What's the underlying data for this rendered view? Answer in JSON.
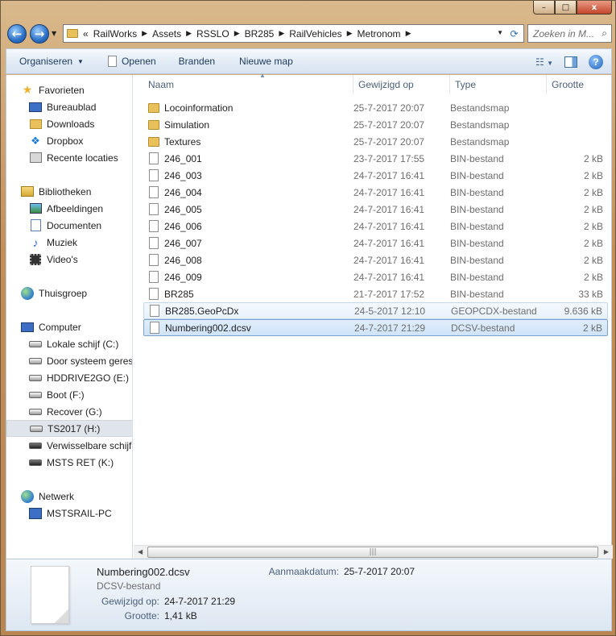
{
  "window": {
    "min_glyph": "–",
    "max_glyph": "□",
    "close_glyph": "x"
  },
  "address": {
    "overflow": "«",
    "crumbs": [
      "RailWorks",
      "Assets",
      "RSSLO",
      "BR285",
      "RailVehicles",
      "Metronom"
    ],
    "search_placeholder": "Zoeken in M..."
  },
  "toolbar": {
    "organize": "Organiseren",
    "open": "Openen",
    "burn": "Branden",
    "new_folder": "Nieuwe map"
  },
  "nav": {
    "favorites": "Favorieten",
    "desktop": "Bureaublad",
    "downloads": "Downloads",
    "dropbox": "Dropbox",
    "recent": "Recente locaties",
    "libraries": "Bibliotheken",
    "pictures": "Afbeeldingen",
    "documents": "Documenten",
    "music": "Muziek",
    "videos": "Video's",
    "homegroup": "Thuisgroep",
    "computer": "Computer",
    "drive_c": "Lokale schijf (C:)",
    "drive_reserved": "Door systeem gereserveerd",
    "drive_e": "HDDRIVE2GO (E:)",
    "drive_f": "Boot (F:)",
    "drive_g": "Recover (G:)",
    "drive_h": "TS2017 (H:)",
    "removable": "Verwisselbare schijf",
    "drive_k": "MSTS RET (K:)",
    "network": "Netwerk",
    "pc": "MSTSRAIL-PC"
  },
  "columns": {
    "name": "Naam",
    "modified": "Gewijzigd op",
    "type": "Type",
    "size": "Grootte"
  },
  "files": [
    {
      "name": "Locoinformation",
      "modified": "25-7-2017 20:07",
      "type": "Bestandsmap",
      "size": "",
      "icon": "folder"
    },
    {
      "name": "Simulation",
      "modified": "25-7-2017 20:07",
      "type": "Bestandsmap",
      "size": "",
      "icon": "folder"
    },
    {
      "name": "Textures",
      "modified": "25-7-2017 20:07",
      "type": "Bestandsmap",
      "size": "",
      "icon": "folder"
    },
    {
      "name": "246_001",
      "modified": "23-7-2017 17:55",
      "type": "BIN-bestand",
      "size": "2 kB",
      "icon": "file"
    },
    {
      "name": "246_003",
      "modified": "24-7-2017 16:41",
      "type": "BIN-bestand",
      "size": "2 kB",
      "icon": "file"
    },
    {
      "name": "246_004",
      "modified": "24-7-2017 16:41",
      "type": "BIN-bestand",
      "size": "2 kB",
      "icon": "file"
    },
    {
      "name": "246_005",
      "modified": "24-7-2017 16:41",
      "type": "BIN-bestand",
      "size": "2 kB",
      "icon": "file"
    },
    {
      "name": "246_006",
      "modified": "24-7-2017 16:41",
      "type": "BIN-bestand",
      "size": "2 kB",
      "icon": "file"
    },
    {
      "name": "246_007",
      "modified": "24-7-2017 16:41",
      "type": "BIN-bestand",
      "size": "2 kB",
      "icon": "file"
    },
    {
      "name": "246_008",
      "modified": "24-7-2017 16:41",
      "type": "BIN-bestand",
      "size": "2 kB",
      "icon": "file"
    },
    {
      "name": "246_009",
      "modified": "24-7-2017 16:41",
      "type": "BIN-bestand",
      "size": "2 kB",
      "icon": "file"
    },
    {
      "name": "BR285",
      "modified": "21-7-2017 17:52",
      "type": "BIN-bestand",
      "size": "33 kB",
      "icon": "file"
    },
    {
      "name": "BR285.GeoPcDx",
      "modified": "24-5-2017 12:10",
      "type": "GEOPCDX-bestand",
      "size": "9.636 kB",
      "icon": "file"
    },
    {
      "name": "Numbering002.dcsv",
      "modified": "24-7-2017 21:29",
      "type": "DCSV-bestand",
      "size": "2 kB",
      "icon": "file"
    }
  ],
  "scroll_grip": "|||",
  "details": {
    "name": "Numbering002.dcsv",
    "type": "DCSV-bestand",
    "modified_label": "Gewijzigd op:",
    "modified_value": "24-7-2017 21:29",
    "size_label": "Grootte:",
    "size_value": "1,41 kB",
    "created_label": "Aanmaakdatum:",
    "created_value": "25-7-2017 20:07"
  }
}
